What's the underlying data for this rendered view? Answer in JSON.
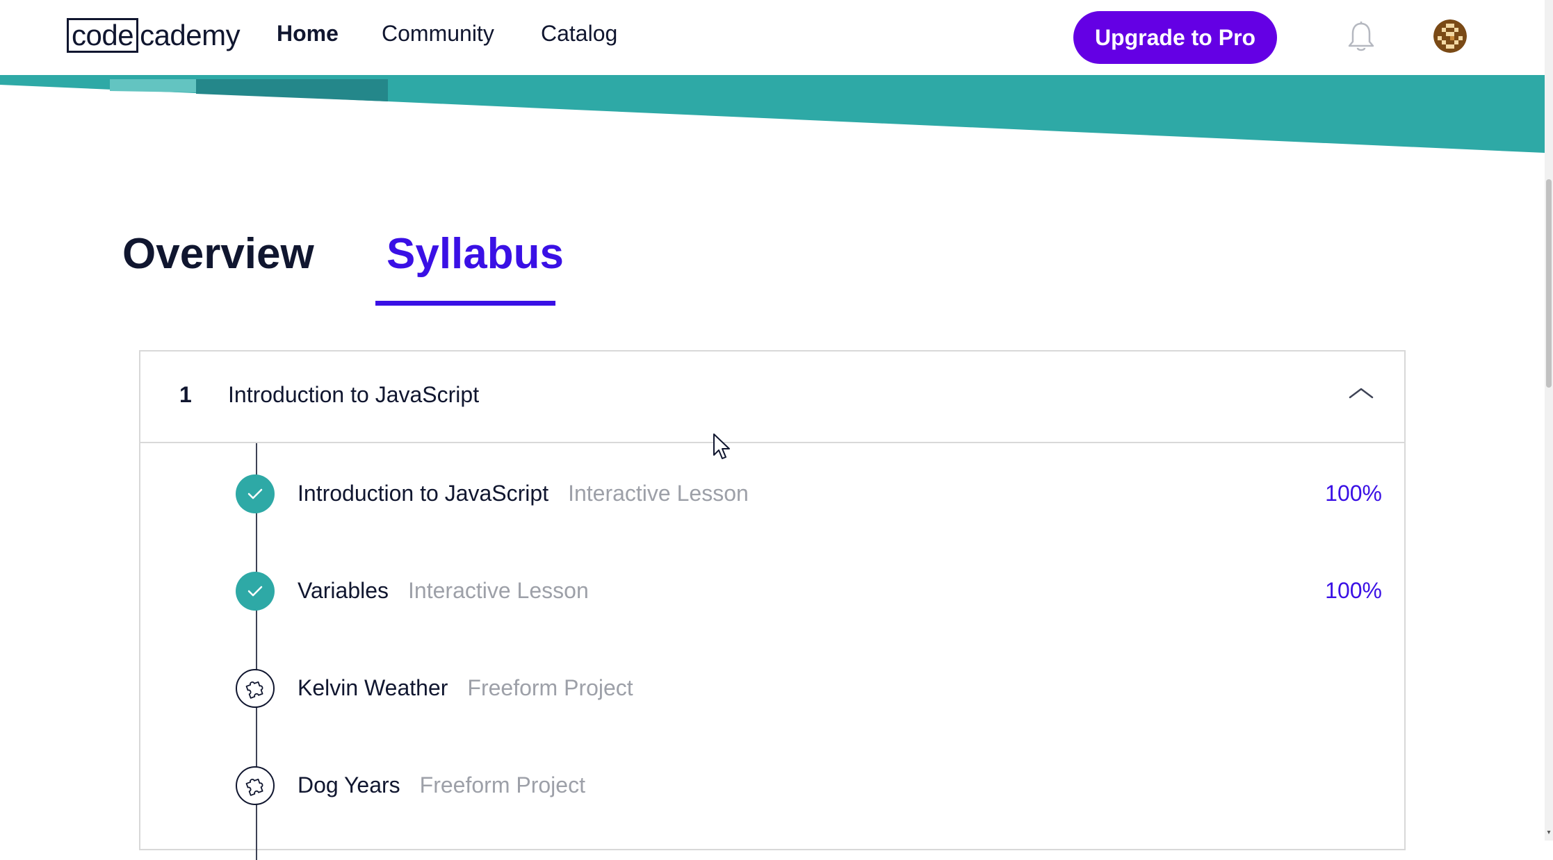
{
  "nav": {
    "logo_code": "code",
    "logo_rest": "cademy",
    "home": "Home",
    "community": "Community",
    "catalog": "Catalog",
    "upgrade": "Upgrade to Pro"
  },
  "tabs": {
    "overview": "Overview",
    "syllabus": "Syllabus",
    "active": "Syllabus"
  },
  "module": {
    "number": "1",
    "title": "Introduction to JavaScript",
    "expanded": true,
    "items": [
      {
        "title": "Introduction to JavaScript",
        "type": "Interactive Lesson",
        "progress": "100%",
        "status": "complete"
      },
      {
        "title": "Variables",
        "type": "Interactive Lesson",
        "progress": "100%",
        "status": "complete"
      },
      {
        "title": "Kelvin Weather",
        "type": "Freeform Project",
        "progress": "",
        "status": "project"
      },
      {
        "title": "Dog Years",
        "type": "Freeform Project",
        "progress": "",
        "status": "project"
      }
    ]
  },
  "colors": {
    "brand_purple": "#6400e4",
    "accent_blue": "#3a10e5",
    "teal": "#2ea9a6",
    "text_dark": "#10162f",
    "text_muted": "#9da0a8"
  },
  "icons": {
    "complete": "check-circle-icon",
    "project": "puzzle-circle-icon",
    "bell": "bell-icon",
    "chevron": "chevron-up-icon"
  }
}
